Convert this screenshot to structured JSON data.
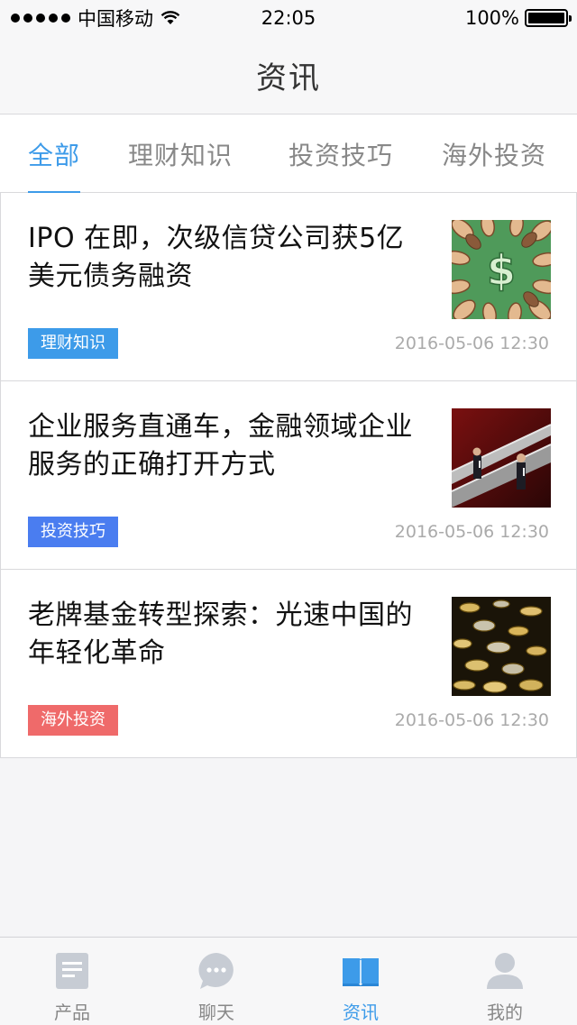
{
  "status_bar": {
    "carrier": "中国移动",
    "time": "22:05",
    "battery": "100%",
    "battery_level": 1.0
  },
  "nav": {
    "title": "资讯"
  },
  "tabs": [
    {
      "label": "全部",
      "active": true
    },
    {
      "label": "理财知识",
      "active": false
    },
    {
      "label": "投资技巧",
      "active": false
    },
    {
      "label": "海外投资",
      "active": false
    }
  ],
  "articles": [
    {
      "title": "IPO 在即，次级信贷公司获5亿美元债务融资",
      "tag": "理财知识",
      "tag_color": "#3d9be9",
      "date": "2016-05-06 12:30",
      "thumb_icon": "dollar-hands-image"
    },
    {
      "title": "企业服务直通车，金融领域企业服务的正确打开方式",
      "tag": "投资技巧",
      "tag_color": "#4a7df0",
      "date": "2016-05-06 12:30",
      "thumb_icon": "escalator-businessmen-image"
    },
    {
      "title": "老牌基金转型探索：光速中国的年轻化革命",
      "tag": "海外投资",
      "tag_color": "#ef6a6a",
      "date": "2016-05-06 12:30",
      "thumb_icon": "falling-coins-image"
    }
  ],
  "tabbar": [
    {
      "label": "产品",
      "icon": "document-icon",
      "active": false
    },
    {
      "label": "聊天",
      "icon": "chat-bubble-icon",
      "active": false
    },
    {
      "label": "资讯",
      "icon": "open-book-icon",
      "active": true
    },
    {
      "label": "我的",
      "icon": "user-icon",
      "active": false
    }
  ],
  "colors": {
    "accent": "#3d9be9",
    "inactive": "#888888",
    "background": "#f5f5f7"
  }
}
